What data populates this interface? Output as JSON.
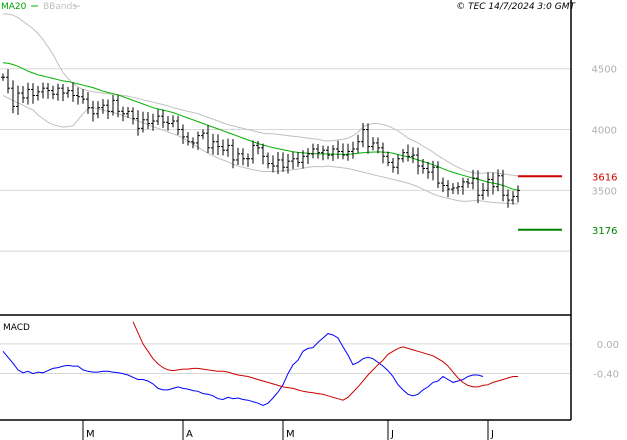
{
  "header": {
    "legend_ma": "MA20",
    "legend_bb": "BBands",
    "copyright": "© TEC 14/7/2024 3:0 GMT"
  },
  "colors": {
    "ma": "#00b000",
    "bb": "#c0c0c0",
    "price": "#000000",
    "macd": "#0000ff",
    "signal": "#cc0000",
    "resistance": "#cc0000",
    "support": "#008000",
    "grid": "#d8d8d8",
    "axis_text": "#b0b0b0"
  },
  "chart_data": [
    {
      "type": "ohlc",
      "title": "",
      "ylim": [
        2500,
        4950
      ],
      "yticks": [
        {
          "value": 4500,
          "label": "4500"
        },
        {
          "value": 4000,
          "label": "4000"
        },
        {
          "value": 3500,
          "label": "3500"
        }
      ],
      "x_labels": [
        {
          "index": 16,
          "label": "M"
        },
        {
          "index": 36,
          "label": "A"
        },
        {
          "index": 56,
          "label": "M"
        },
        {
          "index": 77,
          "label": "J"
        },
        {
          "index": 97,
          "label": "J"
        }
      ],
      "n_bars": 104,
      "close": [
        4430,
        4340,
        4190,
        4300,
        4260,
        4330,
        4280,
        4310,
        4340,
        4320,
        4290,
        4340,
        4300,
        4320,
        4280,
        4270,
        4250,
        4180,
        4130,
        4180,
        4200,
        4150,
        4240,
        4150,
        4130,
        4150,
        4090,
        4010,
        4080,
        4050,
        4070,
        4110,
        4060,
        4050,
        4070,
        4000,
        3940,
        3900,
        3890,
        3950,
        3970,
        3850,
        3900,
        3860,
        3830,
        3870,
        3750,
        3800,
        3760,
        3760,
        3870,
        3850,
        3780,
        3720,
        3700,
        3750,
        3690,
        3740,
        3760,
        3730,
        3780,
        3800,
        3840,
        3810,
        3830,
        3790,
        3840,
        3820,
        3790,
        3820,
        3840,
        3900,
        4000,
        3860,
        3890,
        3850,
        3780,
        3730,
        3690,
        3760,
        3810,
        3780,
        3790,
        3700,
        3680,
        3650,
        3690,
        3560,
        3540,
        3510,
        3520,
        3530,
        3570,
        3560,
        3600,
        3460,
        3500,
        3590,
        3530,
        3620,
        3460,
        3420,
        3450,
        3500
      ],
      "ma": {
        "name": "MA20",
        "start": 0,
        "values": [
          4550,
          4545,
          4535,
          4520,
          4500,
          4480,
          4465,
          4450,
          4440,
          4430,
          4420,
          4410,
          4400,
          4395,
          4385,
          4375,
          4365,
          4355,
          4345,
          4330,
          4315,
          4305,
          4295,
          4285,
          4270,
          4255,
          4240,
          4225,
          4210,
          4195,
          4180,
          4170,
          4160,
          4150,
          4140,
          4125,
          4110,
          4095,
          4080,
          4065,
          4050,
          4035,
          4020,
          4005,
          3990,
          3975,
          3960,
          3945,
          3930,
          3915,
          3900,
          3885,
          3872,
          3862,
          3852,
          3843,
          3834,
          3825,
          3818,
          3812,
          3808,
          3805,
          3802,
          3800,
          3800,
          3800,
          3798,
          3797,
          3796,
          3797,
          3800,
          3805,
          3810,
          3813,
          3815,
          3816,
          3815,
          3812,
          3805,
          3795,
          3785,
          3775,
          3764,
          3750,
          3737,
          3725,
          3710,
          3695,
          3678,
          3662,
          3648,
          3635,
          3624,
          3612,
          3600,
          3590,
          3580,
          3568,
          3560,
          3552,
          3540,
          3525,
          3510,
          3500
        ]
      },
      "bb_upper": {
        "name": "BBands",
        "start": 0,
        "values": [
          4950,
          4950,
          4940,
          4920,
          4890,
          4860,
          4830,
          4790,
          4740,
          4680,
          4620,
          4540,
          4470,
          4420,
          4380,
          4350,
          4330,
          4320,
          4310,
          4305,
          4300,
          4295,
          4290,
          4285,
          4280,
          4275,
          4265,
          4255,
          4245,
          4235,
          4225,
          4215,
          4205,
          4195,
          4180,
          4170,
          4160,
          4150,
          4140,
          4130,
          4115,
          4100,
          4085,
          4070,
          4055,
          4040,
          4030,
          4020,
          4010,
          4000,
          3990,
          3980,
          3970,
          3965,
          3965,
          3960,
          3955,
          3950,
          3945,
          3940,
          3935,
          3930,
          3925,
          3920,
          3910,
          3905,
          3910,
          3915,
          3920,
          3930,
          3950,
          3980,
          4020,
          4040,
          4050,
          4050,
          4040,
          4030,
          4010,
          3990,
          3960,
          3930,
          3910,
          3890,
          3865,
          3840,
          3815,
          3785,
          3760,
          3735,
          3710,
          3690,
          3670,
          3655,
          3645,
          3640,
          3640,
          3645,
          3645,
          3640,
          3635,
          3630,
          3625,
          3620
        ]
      },
      "bb_lower": {
        "name": "BBands",
        "start": 0,
        "values": [
          4280,
          4260,
          4240,
          4220,
          4200,
          4180,
          4160,
          4120,
          4090,
          4060,
          4040,
          4030,
          4020,
          4025,
          4030,
          4080,
          4130,
          4170,
          4180,
          4170,
          4160,
          4150,
          4140,
          4130,
          4115,
          4100,
          4085,
          4070,
          4055,
          4040,
          4025,
          4010,
          3995,
          3980,
          3965,
          3950,
          3930,
          3905,
          3880,
          3855,
          3830,
          3805,
          3785,
          3765,
          3750,
          3735,
          3715,
          3700,
          3690,
          3680,
          3670,
          3662,
          3655,
          3655,
          3655,
          3658,
          3660,
          3665,
          3670,
          3675,
          3682,
          3690,
          3695,
          3695,
          3695,
          3700,
          3695,
          3690,
          3685,
          3680,
          3670,
          3660,
          3650,
          3640,
          3630,
          3620,
          3610,
          3600,
          3590,
          3580,
          3570,
          3560,
          3545,
          3530,
          3510,
          3490,
          3470,
          3455,
          3445,
          3435,
          3425,
          3415,
          3410,
          3410,
          3415,
          3420,
          3410,
          3405,
          3400,
          3398,
          3395,
          3392,
          3390,
          3390
        ]
      },
      "levels": [
        {
          "name": "Resistance",
          "value": 3616,
          "label": "3616",
          "color": "#cc0000"
        },
        {
          "name": "Support",
          "value": 3176,
          "label": "3176",
          "color": "#008000"
        }
      ]
    },
    {
      "type": "line",
      "title": "MACD",
      "ylim": [
        -100,
        35
      ],
      "yticks": [
        {
          "value": 0,
          "label": "0.00"
        },
        {
          "value": -40,
          "label": "-0.40"
        }
      ],
      "series": [
        {
          "name": "MACD",
          "values": [
            -10,
            -18,
            -26,
            -35,
            -39,
            -37,
            -40,
            -38,
            -39,
            -36,
            -33,
            -32,
            -30,
            -29,
            -30,
            -30,
            -35,
            -37,
            -38,
            -38,
            -37,
            -37,
            -38,
            -39,
            -40,
            -42,
            -45,
            -48,
            -48,
            -50,
            -54,
            -60,
            -62,
            -62,
            -60,
            -58,
            -60,
            -61,
            -63,
            -64,
            -67,
            -68,
            -70,
            -74,
            -75,
            -72,
            -74,
            -73,
            -75,
            -76,
            -78,
            -80,
            -83,
            -80,
            -73,
            -65,
            -55,
            -40,
            -28,
            -22,
            -10,
            -6,
            -5,
            2,
            8,
            14,
            12,
            8,
            -4,
            -15,
            -28,
            -25,
            -20,
            -18,
            -20,
            -25,
            -30,
            -36,
            -44,
            -55,
            -62,
            -68,
            -70,
            -68,
            -62,
            -58,
            -52,
            -50,
            -44,
            -48,
            -52,
            -50,
            -48,
            -44,
            -42,
            -42,
            -44
          ]
        },
        {
          "name": "Signal",
          "values": [
            30,
            15,
            0,
            -10,
            -20,
            -27,
            -32,
            -35,
            -36,
            -35,
            -34,
            -34,
            -33,
            -33,
            -34,
            -35,
            -36,
            -37,
            -37,
            -38,
            -40,
            -42,
            -43,
            -44,
            -46,
            -48,
            -50,
            -52,
            -54,
            -56,
            -58,
            -59,
            -60,
            -62,
            -64,
            -65,
            -66,
            -67,
            -68,
            -70,
            -72,
            -74,
            -76,
            -72,
            -65,
            -58,
            -50,
            -42,
            -35,
            -28,
            -22,
            -14,
            -10,
            -6,
            -4,
            -6,
            -8,
            -10,
            -12,
            -14,
            -16,
            -20,
            -24,
            -30,
            -38,
            -46,
            -52,
            -56,
            -58,
            -58,
            -56,
            -55,
            -52,
            -50,
            -48,
            -46,
            -44,
            -44
          ]
        }
      ],
      "start_index": [
        0,
        26
      ]
    }
  ]
}
